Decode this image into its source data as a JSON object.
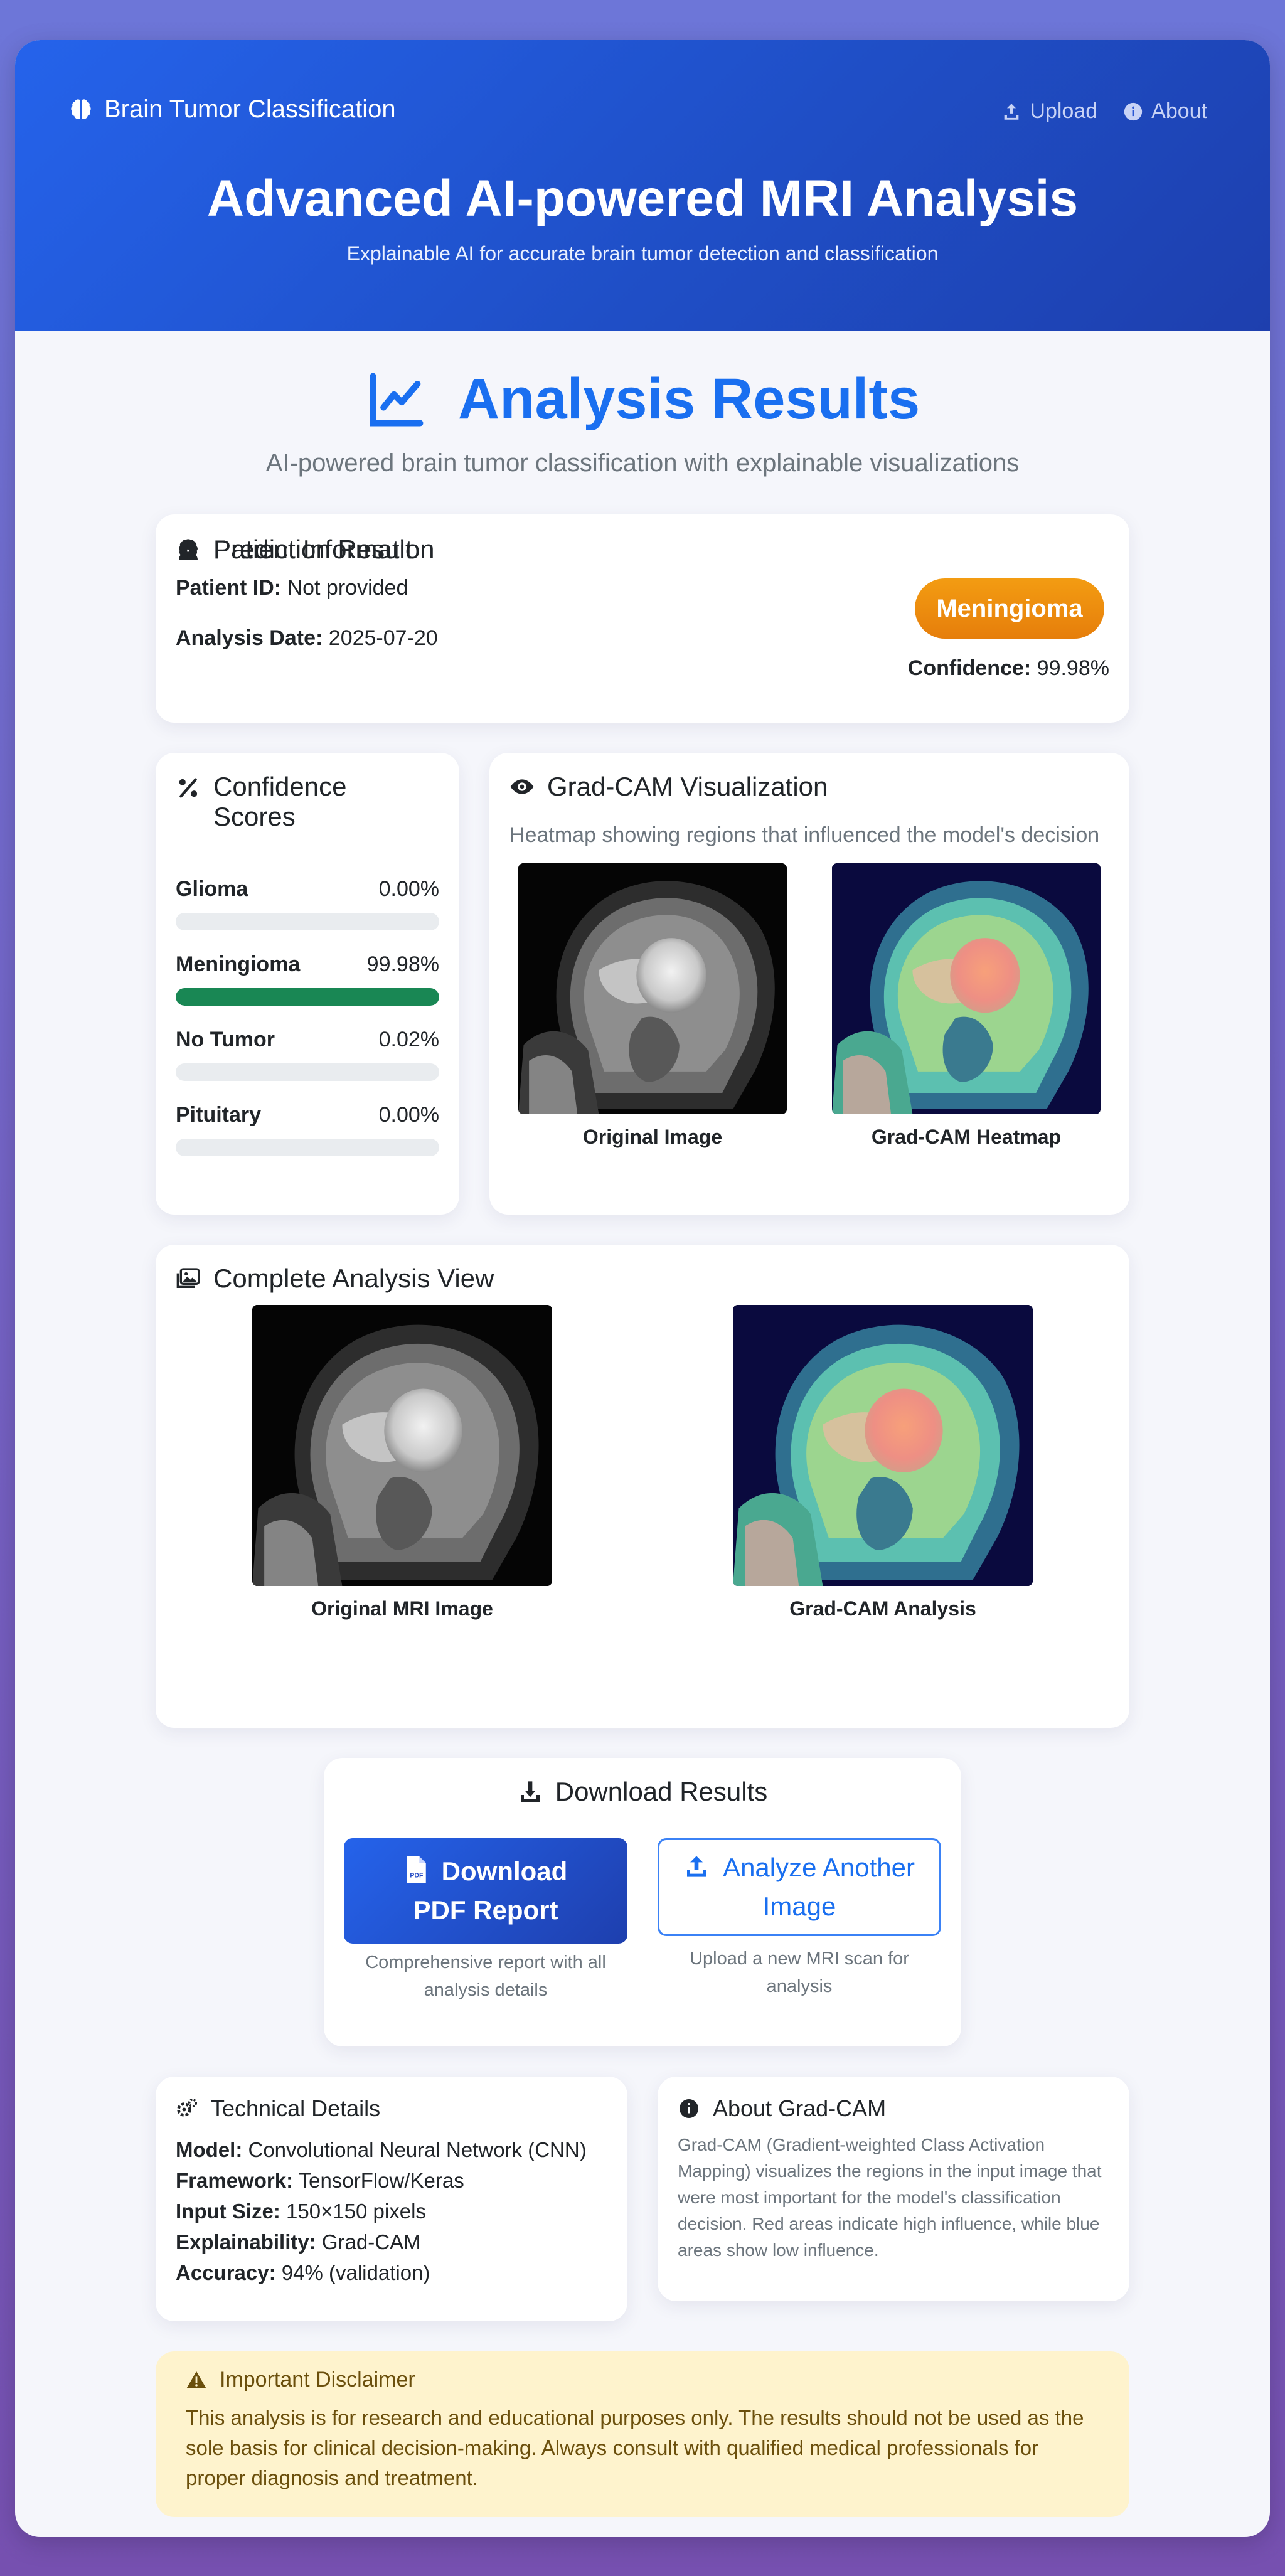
{
  "header": {
    "brand": "Brain Tumor Classification",
    "nav": [
      {
        "label": "Upload",
        "icon": "upload-icon"
      },
      {
        "label": "About",
        "icon": "info-icon"
      }
    ],
    "title": "Advanced AI-powered MRI Analysis",
    "subtitle": "Explainable AI for accurate brain tumor detection and classification"
  },
  "results": {
    "title": "Analysis Results",
    "subtitle": "AI-powered brain tumor classification with explainable visualizations"
  },
  "patient": {
    "heading": "Patient Information",
    "id_label": "Patient ID:",
    "id_value": "Not provided",
    "date_label": "Analysis Date:",
    "date_value": "2025-07-20",
    "prediction_heading": "Prediction Result",
    "prediction": "Meningioma",
    "confidence_label": "Confidence:",
    "confidence_value": "99.98%"
  },
  "scores": {
    "heading": "Confidence Scores",
    "items": [
      {
        "label": "Glioma",
        "value": "0.00%",
        "fraction": 0.0
      },
      {
        "label": "Meningioma",
        "value": "99.98%",
        "fraction": 0.9998
      },
      {
        "label": "No Tumor",
        "value": "0.02%",
        "fraction": 0.0002
      },
      {
        "label": "Pituitary",
        "value": "0.00%",
        "fraction": 0.0
      }
    ]
  },
  "gradcam": {
    "heading": "Grad-CAM Visualization",
    "note": "Heatmap showing regions that influenced the model's decision",
    "original_caption": "Original Image",
    "heatmap_caption": "Grad-CAM Heatmap"
  },
  "complete": {
    "heading": "Complete Analysis View",
    "original_caption": "Original MRI Image",
    "gradcam_caption": "Grad-CAM Analysis"
  },
  "download": {
    "heading": "Download Results",
    "pdf_line1": "Download",
    "pdf_line2": "PDF Report",
    "pdf_note": "Comprehensive report with all analysis details",
    "again_line1": "Analyze Another",
    "again_line2": "Image",
    "again_note": "Upload a new MRI scan for analysis"
  },
  "tech": {
    "heading": "Technical Details",
    "rows": [
      {
        "label": "Model:",
        "value": "Convolutional Neural Network (CNN)"
      },
      {
        "label": "Framework:",
        "value": "TensorFlow/Keras"
      },
      {
        "label": "Input Size:",
        "value": "150×150 pixels"
      },
      {
        "label": "Explainability:",
        "value": "Grad-CAM"
      },
      {
        "label": "Accuracy:",
        "value": "94% (validation)"
      }
    ]
  },
  "about": {
    "heading": "About Grad-CAM",
    "text": "Grad-CAM (Gradient-weighted Class Activation Mapping) visualizes the regions in the input image that were most important for the model's classification decision. Red areas indicate high influence, while blue areas show low influence."
  },
  "disclaimer": {
    "heading": "Important Disclaimer",
    "text": "This analysis is for research and educational purposes only. The results should not be used as the sole basis for clinical decision-making. Always consult with qualified medical professionals for proper diagnosis and treatment."
  },
  "colors": {
    "brand_blue": "#2563eb",
    "accent_blue": "#1a6ff0",
    "badge_orange": "#f39c12",
    "bar_green": "#198754",
    "disclaimer_bg": "#fef3cd"
  }
}
